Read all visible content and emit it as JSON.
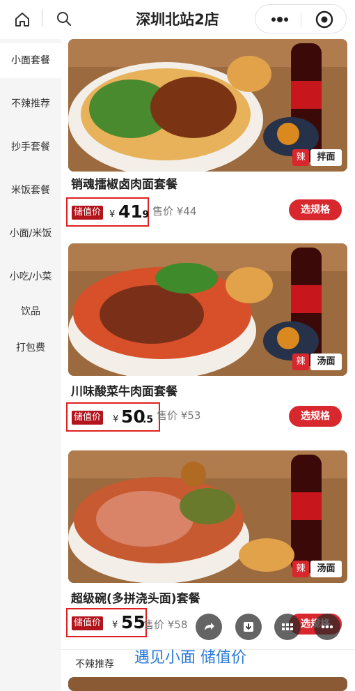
{
  "header": {
    "title": "深圳北站2店",
    "icons": [
      "home-icon",
      "search-icon",
      "more-icon",
      "close-icon"
    ]
  },
  "sidebar": {
    "items": [
      {
        "label": "小面套餐",
        "active": true
      },
      {
        "label": "不辣推荐"
      },
      {
        "label": "抄手套餐"
      },
      {
        "label": "米饭套餐"
      },
      {
        "label": "小面/米饭"
      },
      {
        "label": "小吃/小菜"
      },
      {
        "label": "饮品"
      },
      {
        "label": "打包费"
      }
    ]
  },
  "products": [
    {
      "name": "销魂擂椒卤肉面套餐",
      "tag_spicy": "辣",
      "tag_type": "拌面",
      "stored_value_label": "储值价",
      "currency": "¥",
      "price_main": "41",
      "price_decimal": ".9",
      "original_price": "售价 ¥44",
      "button": "选规格"
    },
    {
      "name": "川味酸菜牛肉面套餐",
      "tag_spicy": "辣",
      "tag_type": "汤面",
      "stored_value_label": "储值价",
      "currency": "¥",
      "price_main": "50",
      "price_decimal": ".5",
      "original_price": "售价 ¥53",
      "button": "选规格"
    },
    {
      "name": "超级碗(多拼浇头面)套餐",
      "tag_spicy": "辣",
      "tag_type": "汤面",
      "stored_value_label": "储值价",
      "currency": "¥",
      "price_main": "55",
      "price_decimal": "",
      "original_price": "售价 ¥58",
      "button": "选规格"
    }
  ],
  "section_header": "不辣推荐",
  "floating_icons": [
    "share-icon",
    "download-icon",
    "grid-icon",
    "more-icon"
  ],
  "overlay_caption": "遇见小面 储值价",
  "colors": {
    "accent_red": "#d9272e",
    "highlight_box": "#e02020",
    "caption_blue": "#2a7ad6"
  }
}
